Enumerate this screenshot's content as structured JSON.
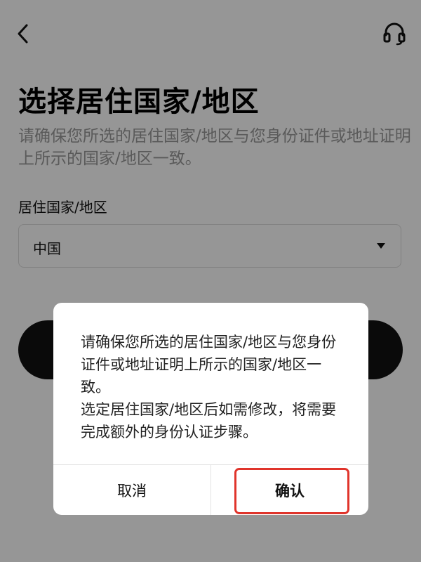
{
  "header": {
    "back_icon": "chevron-left-icon",
    "support_icon": "headset-icon"
  },
  "page": {
    "title": "选择居住国家/地区",
    "subtitle": "请确保您所选的居住国家/地区与您身份证件或地址证明上所示的国家/地区一致。",
    "field_label": "居住国家/地区",
    "selected_country": "中国",
    "dropdown_icon": "caret-down-icon"
  },
  "dialog": {
    "message_line1": "请确保您所选的居住国家/地区与您身份证件或地址证明上所示的国家/地区一致。",
    "message_line2": "选定居住国家/地区后如需修改，将需要完成额外的身份认证步骤。",
    "cancel_label": "取消",
    "confirm_label": "确认"
  },
  "colors": {
    "overlay": "#000000",
    "highlight": "#e0342b",
    "primary_button": "#111111"
  }
}
